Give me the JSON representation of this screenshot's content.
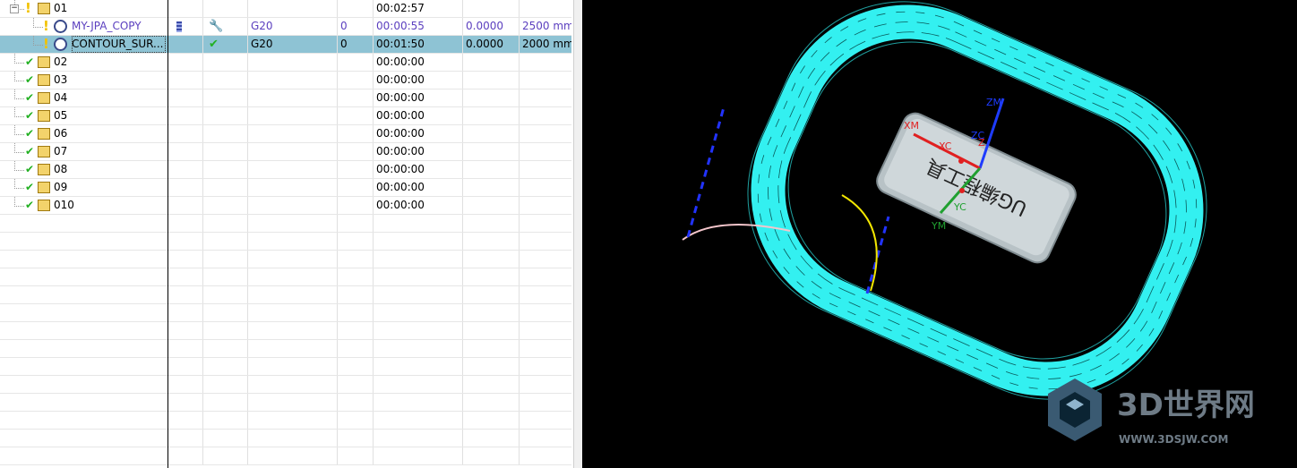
{
  "navigator": {
    "rows": [
      {
        "name": "01",
        "tool_changes": "",
        "tool": "",
        "path": "",
        "cutcom": "",
        "time": "00:02:57",
        "stock": "",
        "feed": "",
        "status": "warn",
        "level": 1,
        "kind": "group"
      },
      {
        "name": "MY-JPA_COPY",
        "tool_changes": "",
        "tool": "",
        "path": "G20",
        "cutcom": "0",
        "time": "00:00:55",
        "stock": "0.0000",
        "feed": "2500 mm",
        "status": "warn",
        "level": 2,
        "kind": "op"
      },
      {
        "name": "CONTOUR_SUR...",
        "tool_changes": "",
        "tool": "",
        "path": "G20",
        "cutcom": "0",
        "time": "00:01:50",
        "stock": "0.0000",
        "feed": "2000 mm",
        "status": "warn",
        "level": 2,
        "kind": "op",
        "selected": true
      },
      {
        "name": "02",
        "time": "00:00:00",
        "status": "ok",
        "level": 1,
        "kind": "group"
      },
      {
        "name": "03",
        "time": "00:00:00",
        "status": "ok",
        "level": 1,
        "kind": "group"
      },
      {
        "name": "04",
        "time": "00:00:00",
        "status": "ok",
        "level": 1,
        "kind": "group"
      },
      {
        "name": "05",
        "time": "00:00:00",
        "status": "ok",
        "level": 1,
        "kind": "group"
      },
      {
        "name": "06",
        "time": "00:00:00",
        "status": "ok",
        "level": 1,
        "kind": "group"
      },
      {
        "name": "07",
        "time": "00:00:00",
        "status": "ok",
        "level": 1,
        "kind": "group"
      },
      {
        "name": "08",
        "time": "00:00:00",
        "status": "ok",
        "level": 1,
        "kind": "group"
      },
      {
        "name": "09",
        "time": "00:00:00",
        "status": "ok",
        "level": 1,
        "kind": "group"
      },
      {
        "name": "010",
        "time": "00:00:00",
        "status": "ok",
        "level": 1,
        "kind": "group"
      }
    ],
    "empty_rows": 14
  },
  "viewport": {
    "axis_labels": {
      "xm": "XM",
      "xc": "XC",
      "zm": "ZM",
      "zc": "ZC",
      "z": "Z",
      "ym": "YM",
      "yc": "YC"
    },
    "part_text": "UG编程工具",
    "background": "#000000",
    "toolpath_color": "#33f0f0"
  },
  "watermark": {
    "brand": "3D世界网",
    "url": "WWW.3DSJW.COM"
  },
  "colors": {
    "warn": "#f2c200",
    "ok": "#22b022",
    "selected_row": "#8ec3d4",
    "op_text": "#5b3fbf"
  }
}
